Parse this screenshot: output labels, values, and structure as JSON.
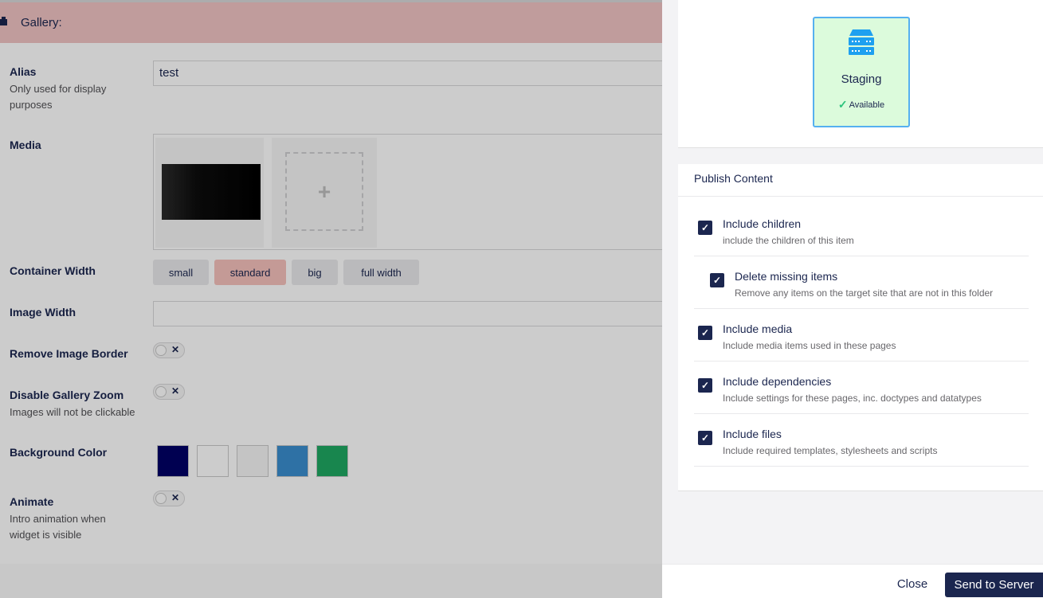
{
  "editor": {
    "header_title": "Gallery:",
    "alias": {
      "label": "Alias",
      "description": "Only used for display purposes",
      "value": "test"
    },
    "media": {
      "label": "Media",
      "add_symbol": "+"
    },
    "container_width": {
      "label": "Container Width",
      "options": [
        "small",
        "standard",
        "big",
        "full width"
      ],
      "selected": "standard"
    },
    "image_width": {
      "label": "Image Width",
      "value": ""
    },
    "remove_image_border": {
      "label": "Remove Image Border",
      "toggle_symbol": "✕"
    },
    "disable_gallery_zoom": {
      "label": "Disable Gallery Zoom",
      "description": "Images will not be clickable",
      "toggle_symbol": "✕"
    },
    "background_color": {
      "label": "Background Color",
      "swatches": [
        "#000066",
        "#ffffff",
        "#f6f6f6",
        "#3a8ecf",
        "#1ea862"
      ]
    },
    "animate": {
      "label": "Animate",
      "description": "Intro animation when widget is visible",
      "toggle_symbol": "✕"
    }
  },
  "panel": {
    "server": {
      "name": "Staging",
      "status": "Available",
      "icon": "server-icon",
      "check_symbol": "✓"
    },
    "publish_title": "Publish Content",
    "options": [
      {
        "name": "Include children",
        "description": "include the children of this item",
        "checked": true,
        "indent": false
      },
      {
        "name": "Delete missing items",
        "description": "Remove any items on the target site that are not in this folder",
        "checked": true,
        "indent": true
      },
      {
        "name": "Include media",
        "description": "Include media items used in these pages",
        "checked": true,
        "indent": false
      },
      {
        "name": "Include dependencies",
        "description": "Include settings for these pages, inc. doctypes and datatypes",
        "checked": true,
        "indent": false
      },
      {
        "name": "Include files",
        "description": "Include required templates, stylesheets and scripts",
        "checked": true,
        "indent": false
      }
    ],
    "check_symbol": "✓",
    "close_label": "Close",
    "send_label": "Send to Server"
  },
  "colors": {
    "accent": "#1b264f",
    "header_bg": "#f1c4c4",
    "server_bg": "#dcfbdc",
    "server_border": "#55b0f0",
    "check": "#2bc37c"
  }
}
